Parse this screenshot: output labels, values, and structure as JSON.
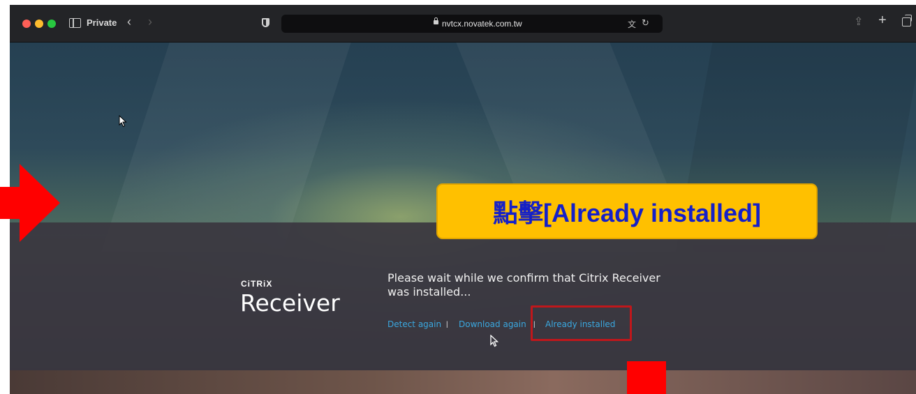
{
  "browser": {
    "private_label": "Private",
    "url": "nvtcx.novatek.com.tw",
    "icons": [
      "sidebar-icon",
      "back-arrow-icon",
      "forward-arrow-icon",
      "shield-icon",
      "lock-icon",
      "translate-icon",
      "reload-icon",
      "share-icon",
      "plus-icon",
      "tabs-overview-icon"
    ]
  },
  "page": {
    "logo_text": "CiTRiX",
    "product_name": "Receiver",
    "message": "Please wait while we confirm that Citrix Receiver was installed...",
    "links": {
      "detect_again": "Detect again",
      "download_again": "Download again",
      "already_installed": "Already installed"
    },
    "separator": "|"
  },
  "annotation": {
    "callout_text": "點擊[Already installed]",
    "callout_bg": "#ffc000",
    "callout_text_color": "#1520c8",
    "highlight_color": "#c0171b",
    "arrow_color": "#ff0000"
  }
}
